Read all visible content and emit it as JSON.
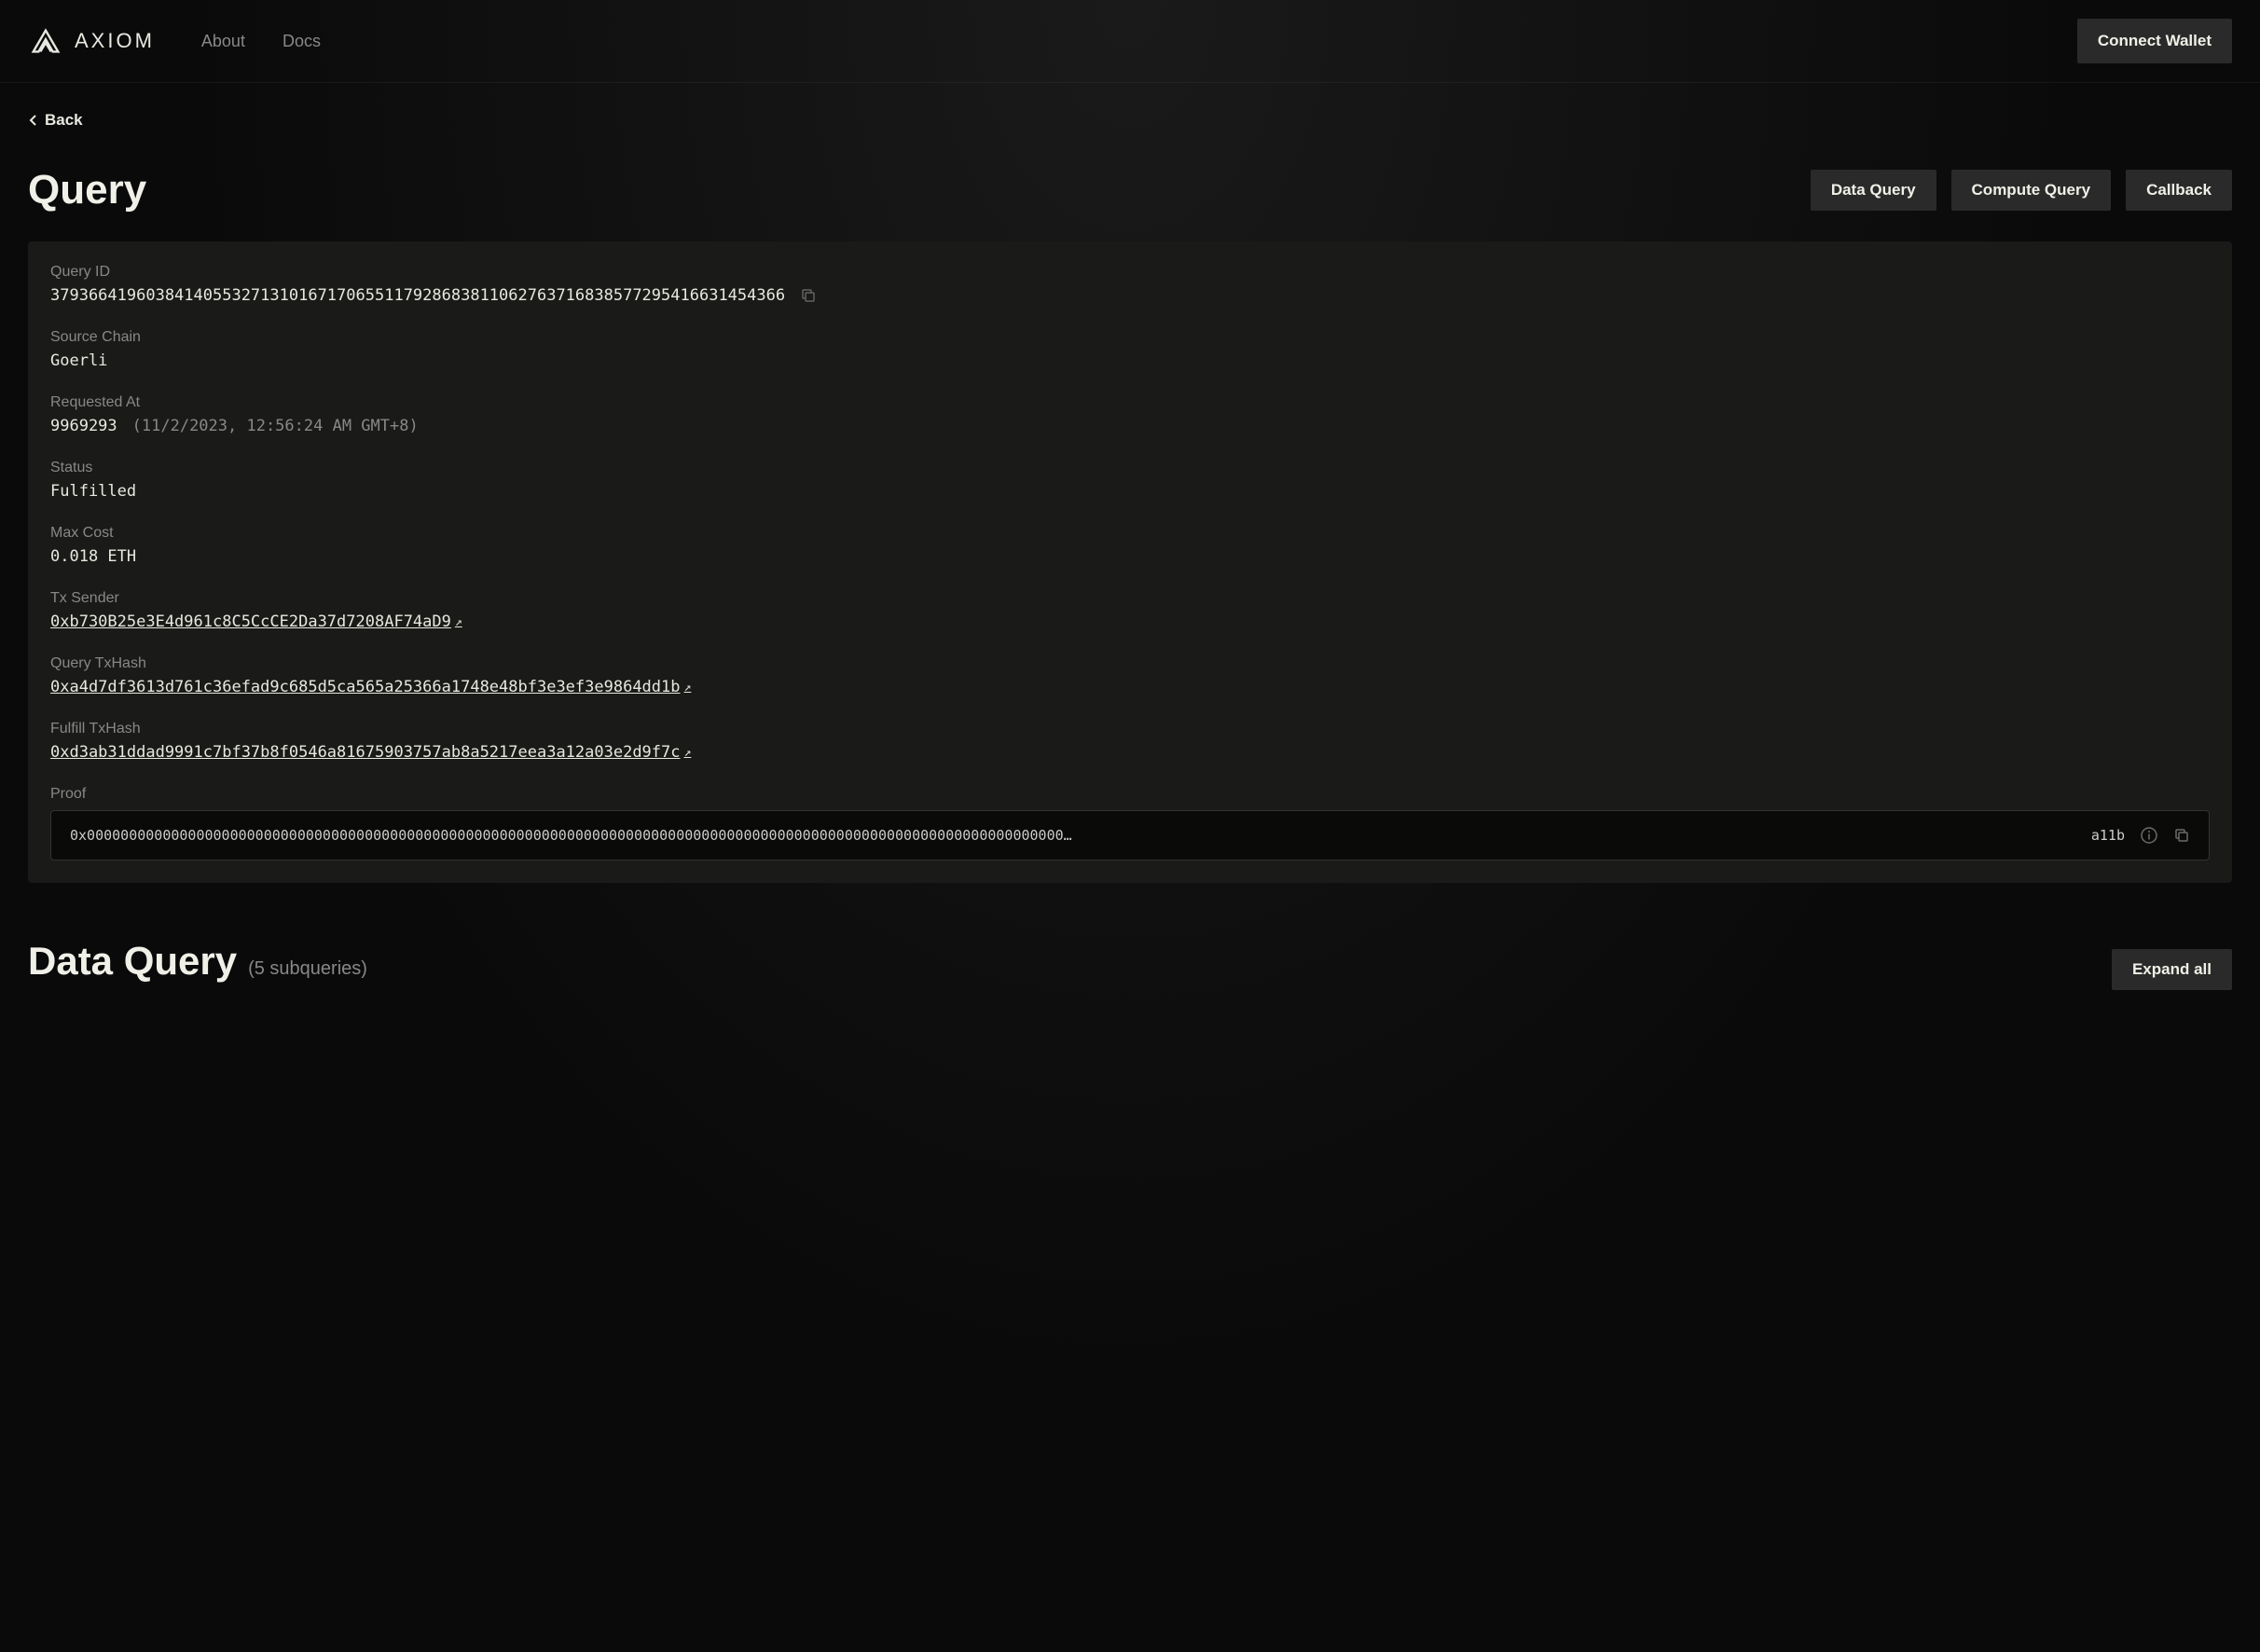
{
  "header": {
    "brand": "AXIOM",
    "nav": {
      "about": "About",
      "docs": "Docs"
    },
    "connect_wallet": "Connect Wallet"
  },
  "back_label": "Back",
  "page_title": "Query",
  "tabs": {
    "data_query": "Data Query",
    "compute_query": "Compute Query",
    "callback": "Callback"
  },
  "fields": {
    "query_id": {
      "label": "Query ID",
      "value": "37936641960384140553271310167170655117928683811062763716838577295416631454366"
    },
    "source_chain": {
      "label": "Source Chain",
      "value": "Goerli"
    },
    "requested_at": {
      "label": "Requested At",
      "block": "9969293",
      "timestamp": "(11/2/2023, 12:56:24 AM GMT+8)"
    },
    "status": {
      "label": "Status",
      "value": "Fulfilled"
    },
    "max_cost": {
      "label": "Max Cost",
      "value": "0.018 ETH"
    },
    "tx_sender": {
      "label": "Tx Sender",
      "value": "0xb730B25e3E4d961c8C5CcCE2Da37d7208AF74aD9"
    },
    "query_txhash": {
      "label": "Query TxHash",
      "value": "0xa4d7df3613d761c36efad9c685d5ca565a25366a1748e48bf3e3ef3e9864dd1b"
    },
    "fulfill_txhash": {
      "label": "Fulfill TxHash",
      "value": "0xd3ab31ddad9991c7bf37b8f0546a81675903757ab8a5217eea3a12a03e2d9f7c"
    },
    "proof": {
      "label": "Proof",
      "text": "0x00000000000000000000000000000000000000000000000000000000000000000000000000000000000000000000000000000000000000000000…",
      "suffix": "a11b"
    }
  },
  "subsection": {
    "title": "Data Query",
    "count": "(5 subqueries)",
    "expand_all": "Expand all"
  }
}
